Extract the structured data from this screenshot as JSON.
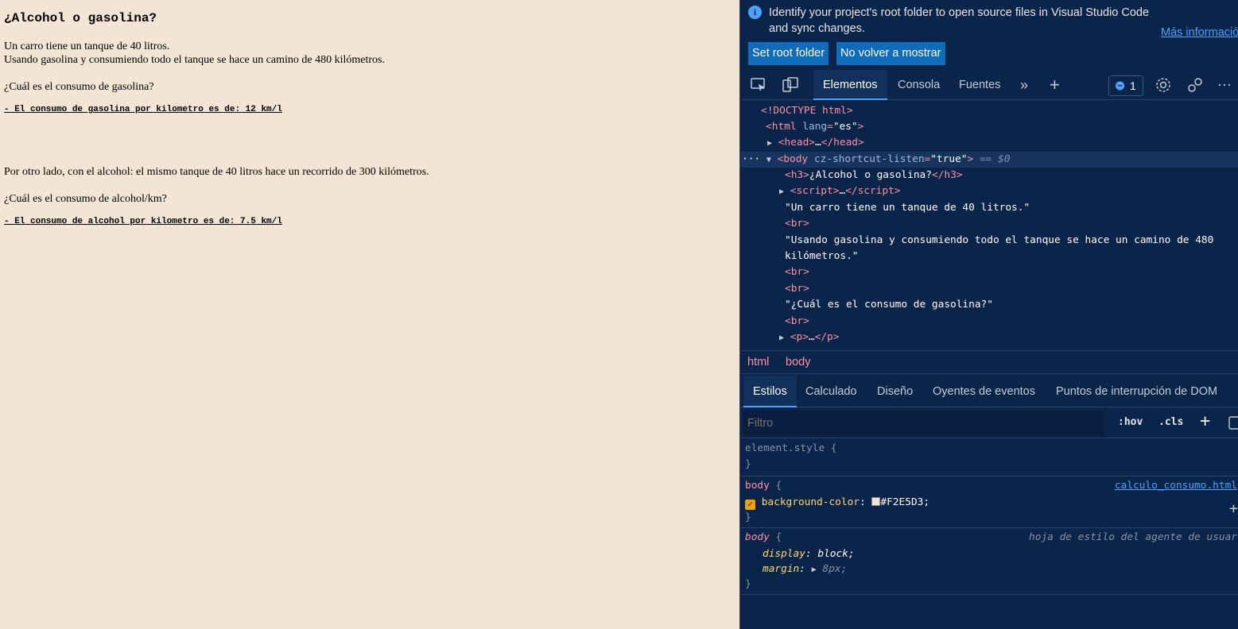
{
  "page": {
    "heading": "¿Alcohol o gasolina?",
    "line1": "Un carro tiene un tanque de 40 litros.",
    "line2": "Usando gasolina y consumiendo todo el tanque se hace un camino de 480 kilómetros.",
    "question1": "¿Cuál es el consumo de gasolina?",
    "answer1": "- El consumo de gasolina por kilometro es de: 12 km/l",
    "line3": "Por otro lado, con el alcohol: el mismo tanque de 40 litros hace un recorrido de 300 kilómetros.",
    "question2": "¿Cuál es el consumo de alcohol/km?",
    "answer2": "- El consumo de alcohol por kilometro es de: 7.5 km/l",
    "background": "#F2E5D3"
  },
  "devtools": {
    "infobar": {
      "message": "Identify your project's root folder to open source files in Visual Studio Code and sync changes.",
      "link": "Más informació",
      "btn_root": "Set root folder",
      "btn_dismiss": "No volver a mostrar"
    },
    "tabs": {
      "elements": "Elementos",
      "console": "Consola",
      "sources": "Fuentes",
      "issues_count": "1"
    },
    "dom": {
      "doctype": "<!DOCTYPE html>",
      "html_tag": "html",
      "html_attr": "lang",
      "html_val": "\"es\"",
      "head": "head",
      "body_attr": "cz-shortcut-listen",
      "body_val": "\"true\"",
      "eq0": "== $0",
      "h3_text": "¿Alcohol o gasolina?",
      "text1": "\"Un carro tiene un tanque de 40 litros.\"",
      "text2a": "\"Usando gasolina y consumiendo todo el tanque se hace un camino de 480",
      "text2b": "kilómetros.\"",
      "text3": "\"¿Cuál es el consumo de gasolina?\""
    },
    "breadcrumbs": [
      "html",
      "body"
    ],
    "styles_tabs": [
      "Estilos",
      "Calculado",
      "Diseño",
      "Oyentes de eventos",
      "Puntos de interrupción de DOM"
    ],
    "filter_placeholder": "Filtro",
    "hov": ":hov",
    "cls": ".cls",
    "rules": {
      "element_style": "element.style {",
      "close": "}",
      "body_sel": "body",
      "source": "calculo_consumo.html",
      "bg_prop": "background-color",
      "bg_val": "#F2E5D3;",
      "ua_label": "hoja de estilo del agente de usuar",
      "display_prop": "display",
      "display_val": "block;",
      "margin_prop": "margin",
      "margin_val": "8px;"
    }
  }
}
